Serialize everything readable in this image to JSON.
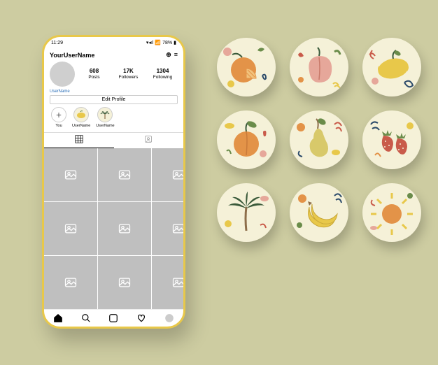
{
  "status": {
    "time": "11:29",
    "signal": "▾◂ıl",
    "wifi": "📶",
    "battery": "78%",
    "battery_icon": "▮"
  },
  "profile": {
    "username": "YourUserName",
    "subuser": "UserName",
    "stats": {
      "posts": "608",
      "posts_label": "Posts",
      "followers": "17K",
      "followers_label": "Followers",
      "following": "1304",
      "following_label": "Following"
    },
    "edit_label": "Edit Profile"
  },
  "highlights": [
    {
      "label": "You",
      "icon": "＋"
    },
    {
      "label": "UserName",
      "icon": "lemon"
    },
    {
      "label": "UserName",
      "icon": "palm"
    }
  ],
  "tabs": {
    "grid": "⊞",
    "tagged": "👤"
  },
  "nav": {
    "home": "home",
    "search": "search",
    "add": "add",
    "activity": "heart",
    "avatar": "avatar"
  },
  "covers": [
    {
      "name": "orange"
    },
    {
      "name": "peach"
    },
    {
      "name": "lemon"
    },
    {
      "name": "apricot"
    },
    {
      "name": "pear"
    },
    {
      "name": "strawberries"
    },
    {
      "name": "palm"
    },
    {
      "name": "banana"
    },
    {
      "name": "sun"
    }
  ],
  "palette": {
    "bg": "#cdcca1",
    "cream": "#f5f1d8",
    "yellow": "#e8c84a",
    "orange": "#e39348",
    "red": "#c95b4a",
    "green": "#6a8c4a",
    "darkgreen": "#3a5a3a",
    "pink": "#e6a79a",
    "brown": "#8d6e4a"
  }
}
